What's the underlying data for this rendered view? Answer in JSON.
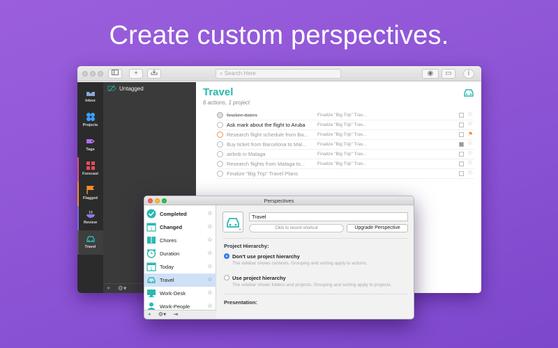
{
  "headline": "Create custom perspectives.",
  "main": {
    "search_placeholder": "Search Here",
    "sidebar": [
      {
        "label": "Inbox",
        "icon": "inbox-icon"
      },
      {
        "label": "Projects",
        "icon": "projects-icon"
      },
      {
        "label": "Tags",
        "icon": "tag-icon"
      },
      {
        "label": "Forecast",
        "icon": "forecast-icon"
      },
      {
        "label": "Flagged",
        "icon": "flag-icon"
      },
      {
        "label": "Review",
        "icon": "review-icon"
      },
      {
        "label": "Travel",
        "icon": "car-icon"
      }
    ],
    "list_header": "Untagged",
    "title": "Travel",
    "subtitle": "6 actions, 1 project",
    "tasks": [
      {
        "name": "finalize dates",
        "project": "Finalize \"Big Trip\" Trav...",
        "state": "done",
        "flag": "none"
      },
      {
        "name": "Ask mark about the flight to Aruba",
        "project": "Finalize \"Big Trip\" Trav...",
        "state": "available",
        "flag": "none"
      },
      {
        "name": "Research flight schedule from Ba...",
        "project": "Finalize \"Big Trip\" Trav...",
        "state": "available",
        "flag": "orange"
      },
      {
        "name": "Buy ticket from Barcelona to Mal...",
        "project": "Finalize \"Big Trip\" Trav...",
        "state": "blocked",
        "flag": "none"
      },
      {
        "name": "airbnb in Malaga",
        "project": "Finalize \"Big Trip\" Trav...",
        "state": "blocked",
        "flag": "none"
      },
      {
        "name": "Research flights from Malaga to...",
        "project": "Finalize \"Big Trip\" Trav...",
        "state": "blocked",
        "flag": "none"
      },
      {
        "name": "Finalize \"Big Trip\" Travel Plans",
        "project": "",
        "state": "blocked",
        "flag": "none"
      }
    ],
    "colors": {
      "accent": "#2ab8b0",
      "sidebar_bg": "#2b2b2b",
      "flag_orange": "#f08a30"
    }
  },
  "perspectives": {
    "window_title": "Perspectives",
    "items": [
      {
        "label": "Completed",
        "bold": true,
        "icon": "check-circle-icon",
        "color": "#2ab8b0"
      },
      {
        "label": "Changed",
        "bold": true,
        "icon": "calendar-icon",
        "color": "#2ab8b0"
      },
      {
        "label": "Chores",
        "bold": false,
        "icon": "book-icon",
        "color": "#2ab8b0"
      },
      {
        "label": "Duration",
        "bold": false,
        "icon": "alarm-clock-icon",
        "color": "#2ab8b0"
      },
      {
        "label": "Today",
        "bold": false,
        "icon": "calendar-icon",
        "color": "#2ab8b0"
      },
      {
        "label": "Travel",
        "bold": false,
        "icon": "car-icon",
        "color": "#2ab8b0",
        "selected": true
      },
      {
        "label": "Work-Desk",
        "bold": false,
        "icon": "desk-icon",
        "color": "#2ab8b0"
      },
      {
        "label": "Work-People",
        "bold": false,
        "icon": "person-icon",
        "color": "#2ab8b0"
      }
    ],
    "name_value": "Travel",
    "shortcut_placeholder": "Click to record shortcut",
    "upgrade_label": "Upgrade Perspective",
    "hierarchy_heading": "Project Hierarchy:",
    "option1_label": "Don't use project hierarchy",
    "option1_desc": "The sidebar shows contexts. Grouping and sorting apply to actions.",
    "option2_label": "Use project hierarchy",
    "option2_desc": "The sidebar shows folders and projects. Grouping and sorting apply to projects.",
    "presentation_heading": "Presentation:"
  }
}
